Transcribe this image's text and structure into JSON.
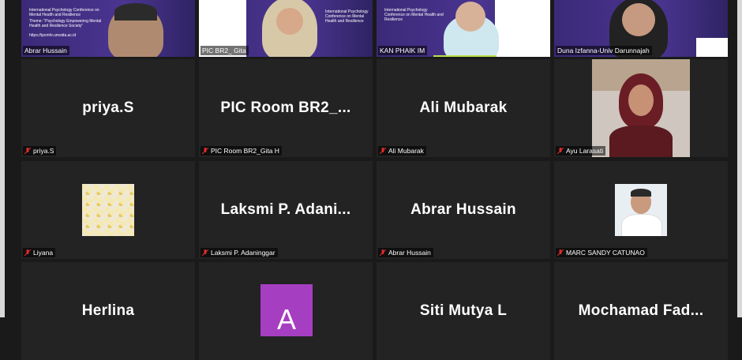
{
  "participants": {
    "row1": [
      {
        "label": "Abrar Hussain"
      },
      {
        "label": "PIC BR2_ Gita"
      },
      {
        "label": "KAN PHAIK IM"
      },
      {
        "label": "Duna Izfanna-Univ Darunnajah"
      }
    ],
    "row2": [
      {
        "name": "priya.S",
        "label": "priya.S"
      },
      {
        "name": "PIC Room  BR2_...",
        "label": "PIC Room BR2_Gita H"
      },
      {
        "name": "Ali Mubarak",
        "label": "Ali Mubarak"
      },
      {
        "label": "Ayu Larasati"
      }
    ],
    "row3": [
      {
        "label": "Liyana"
      },
      {
        "name": "Laksmi  P.  Adani...",
        "label": "Laksmi P. Adaninggar"
      },
      {
        "name": "Abrar Hussain",
        "label": "Abrar Hussain"
      },
      {
        "label": "MARC SANDY CATUNAO"
      }
    ],
    "row4": [
      {
        "name": "Herlina"
      },
      {
        "avatar_letter": "A"
      },
      {
        "name": "Siti Mutya L"
      },
      {
        "name": "Mochamad  Fad..."
      }
    ]
  },
  "slide": {
    "title": "International Psychology Conference on Mental Health and Resilience",
    "theme": "Theme: \"Psychology Empowering Mental Health and Resilience Society\"",
    "url": "https://ipcmhr.umsida.ac.id"
  },
  "colors": {
    "active_speaker": "#b9e04a",
    "tile_bg": "#232323",
    "avatar": "#a63ec2",
    "muted_icon": "#e02b2b"
  }
}
